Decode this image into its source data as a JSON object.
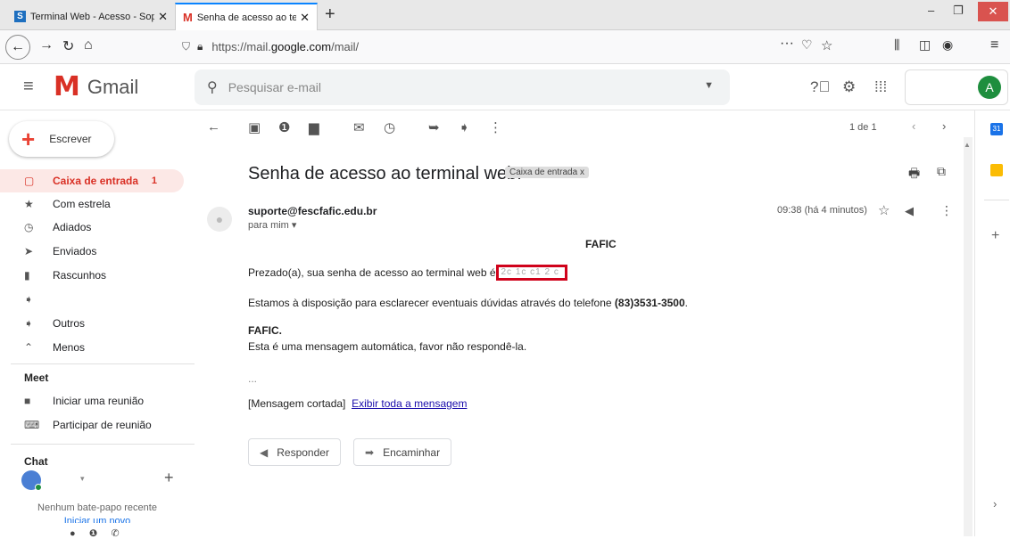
{
  "browser": {
    "tabs": [
      {
        "title": "Terminal Web - Acesso - Soph",
        "favicon": "S"
      },
      {
        "title": "Senha de acesso ao terminal w",
        "favicon": "M"
      }
    ],
    "url_prefix": "https://mail.",
    "url_domain": "google.com",
    "url_suffix": "/mail/"
  },
  "gmail": {
    "app_name": "Gmail",
    "search_placeholder": "Pesquisar e-mail",
    "avatar_letter": "A",
    "compose_label": "Escrever",
    "nav": [
      {
        "label": "Caixa de entrada",
        "count": "1",
        "icon": "inbox-icon"
      },
      {
        "label": "Com estrela",
        "count": "",
        "icon": "star-icon"
      },
      {
        "label": "Adiados",
        "count": "",
        "icon": "clock-icon"
      },
      {
        "label": "Enviados",
        "count": "",
        "icon": "send-icon"
      },
      {
        "label": "Rascunhos",
        "count": "",
        "icon": "draft-icon"
      },
      {
        "label": "",
        "count": "",
        "icon": "label-icon"
      },
      {
        "label": "Outros",
        "count": "",
        "icon": "label-icon"
      },
      {
        "label": "Menos",
        "count": "",
        "icon": "chevron-up-icon"
      }
    ],
    "meet": {
      "title": "Meet",
      "items": [
        "Iniciar uma reunião",
        "Participar de reunião"
      ]
    },
    "chat": {
      "title": "Chat",
      "none_text": "Nenhum bate-papo recente",
      "start_text": "Iniciar um novo"
    }
  },
  "message": {
    "pager": "1 de 1",
    "subject": "Senha de acesso ao terminal web.",
    "label_chip": "Caixa de entrada x",
    "sender": "suporte@fescfafic.edu.br",
    "to": "para mim",
    "time": "09:38 (há 4 minutos)",
    "heading": "FAFIC",
    "line1": "Prezado(a), sua senha de acesso ao terminal web é",
    "password_obscured": "2c 1c  c1 2 c",
    "line2_prefix": "Estamos à disposição para esclarecer eventuais dúvidas através do telefone",
    "phone": "(83)3531-3500",
    "line2_suffix": ".",
    "sign": "FAFIC.",
    "auto_note": "Esta é uma mensagem automática, favor não respondê-la.",
    "ellipsis": "...",
    "clipped": "[Mensagem cortada]",
    "view_all": "Exibir toda a mensagem",
    "reply_label": "Responder",
    "forward_label": "Encaminhar"
  }
}
